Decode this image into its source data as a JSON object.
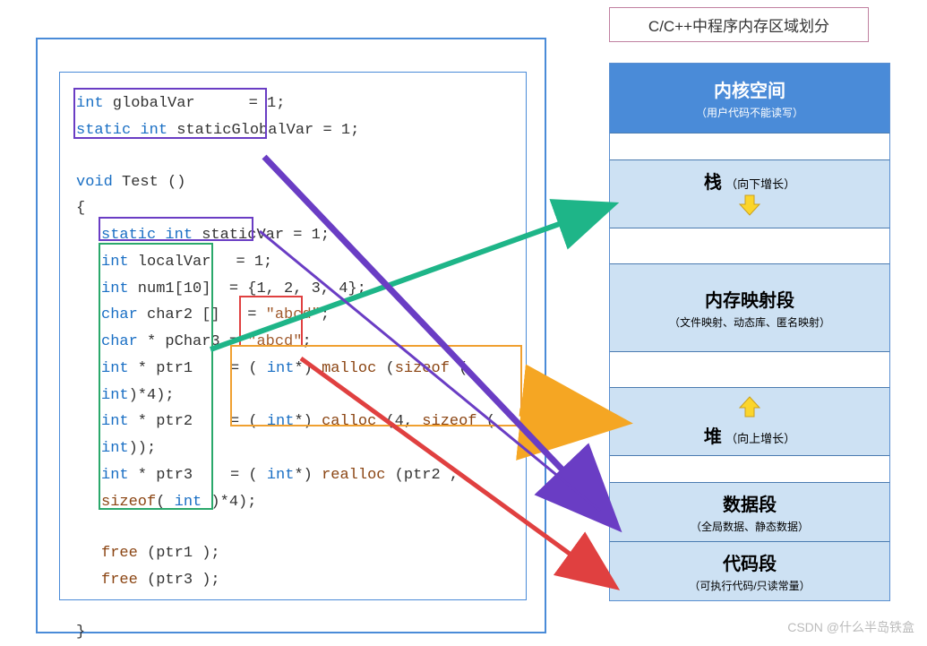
{
  "title": "C/C++中程序内存区域划分",
  "code": {
    "l1_kw": "int",
    "l1_rest": " globalVar",
    "l1_init": "= 1;",
    "l2_kw": "static int",
    "l2_rest": " staticGlobalVar",
    "l2_init": "= 1;",
    "fn_decl_kw": "void",
    "fn_decl_name": " Test ()",
    "brace_open": "{",
    "l3_kw": "static int",
    "l3_rest": " staticVar",
    "l3_init": "= 1;",
    "l4_kw": "int",
    "l4_rest": " localVar",
    "l4_init": "= 1;",
    "l5_kw": "int",
    "l5_rest": " num1[10]",
    "l5_init": "= {1, 2, 3, 4};",
    "l6_kw": "char",
    "l6_rest": " char2 []",
    "l6_eq": "= ",
    "l6_str": "\"abcd\"",
    "l6_semi": ";",
    "l7_kw": "char",
    "l7_rest": " * pChar3",
    "l7_eq": "= ",
    "l7_str": "\"abcd\"",
    "l7_semi": ";",
    "l8_kw": "int",
    "l8_rest": " * ptr1",
    "l8_eq": "= ( ",
    "l8_cast": "int",
    "l8_rest2": "*) ",
    "l8_fn": "malloc",
    "l8_p1": " (",
    "l8_fn2": "sizeof",
    "l8_p2": " ( ",
    "l8_kw2": "int",
    "l8_p3": ")*4);",
    "l9_kw": "int",
    "l9_rest": " * ptr2",
    "l9_eq": "= ( ",
    "l9_cast": "int",
    "l9_rest2": "*) ",
    "l9_fn": "calloc",
    "l9_p1": " (4, ",
    "l9_fn2": "sizeof",
    "l9_p2": " ( ",
    "l9_kw2": "int",
    "l9_p3": "));",
    "l10_kw": "int",
    "l10_rest": " * ptr3",
    "l10_eq": "= ( ",
    "l10_cast": "int",
    "l10_rest2": "*) ",
    "l10_fn": "realloc",
    "l10_p1": " (ptr2 , ",
    "l10_fn2": "sizeof",
    "l10_p2": "( ",
    "l10_kw2": "int",
    "l10_p3": " )*4);",
    "free1_fn": "free",
    "free1_arg": " (ptr1 );",
    "free2_fn": "free",
    "free2_arg": " (ptr3 );",
    "brace_close": "}"
  },
  "memory": {
    "kernel": {
      "title": "内核空间",
      "sub": "（用户代码不能读写）"
    },
    "stack": {
      "title": "栈",
      "sub": "（向下增长）"
    },
    "mmap": {
      "title": "内存映射段",
      "sub": "（文件映射、动态库、匿名映射）"
    },
    "heap": {
      "title": "堆",
      "sub": "（向上增长）"
    },
    "data": {
      "title": "数据段",
      "sub": "（全局数据、静态数据）"
    },
    "text": {
      "title": "代码段",
      "sub": "（可执行代码/只读常量）"
    }
  },
  "watermark": "CSDN @什么半岛铁盒"
}
